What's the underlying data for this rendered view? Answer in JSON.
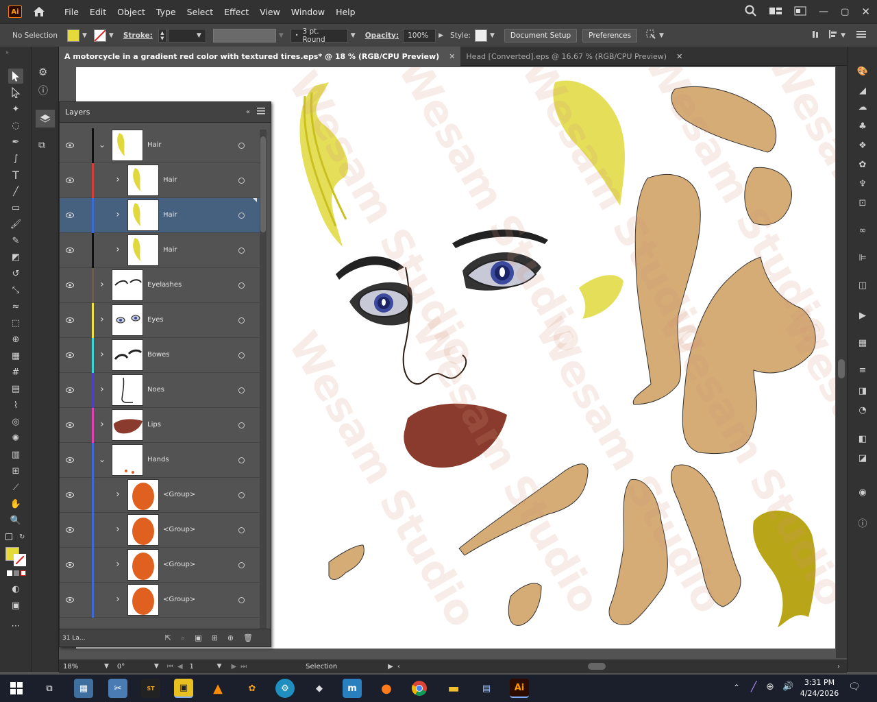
{
  "app": {
    "logo": "Ai",
    "menus": [
      "File",
      "Edit",
      "Object",
      "Type",
      "Select",
      "Effect",
      "View",
      "Window",
      "Help"
    ]
  },
  "control_bar": {
    "selection": "No Selection",
    "fill_color": "#e6d93b",
    "stroke_label": "Stroke:",
    "stroke_profile": "3 pt. Round",
    "opacity_label": "Opacity:",
    "opacity_value": "100%",
    "style_label": "Style:",
    "document_setup": "Document Setup",
    "preferences": "Preferences"
  },
  "tabs": [
    {
      "label": "A motorcycle in a gradient red color with textured tires.eps* @ 18 % (RGB/CPU Preview)",
      "active": true
    },
    {
      "label": "Head [Converted].eps @ 16.67 % (RGB/CPU Preview)",
      "active": false
    }
  ],
  "layers_panel": {
    "title": "Layers",
    "footer_count": "31 La...",
    "rows": [
      {
        "name": "Hair",
        "color": "#111111",
        "level": 0,
        "expanded": true,
        "selected": false
      },
      {
        "name": "Hair",
        "color": "#d53d3d",
        "level": 1,
        "expanded": false,
        "selected": false
      },
      {
        "name": "Hair",
        "color": "#3a6ad6",
        "level": 1,
        "expanded": false,
        "selected": true
      },
      {
        "name": "Hair",
        "color": "#111111",
        "level": 1,
        "expanded": false,
        "selected": false
      },
      {
        "name": "Eyelashes",
        "color": "#6b5d4e",
        "level": 0,
        "expanded": false,
        "selected": false
      },
      {
        "name": "Eyes",
        "color": "#f0e040",
        "level": 0,
        "expanded": false,
        "selected": false
      },
      {
        "name": "Bowes",
        "color": "#3ad6d6",
        "level": 0,
        "expanded": false,
        "selected": false
      },
      {
        "name": "Noes",
        "color": "#5040c0",
        "level": 0,
        "expanded": false,
        "selected": false
      },
      {
        "name": "Lips",
        "color": "#e040b0",
        "level": 0,
        "expanded": false,
        "selected": false
      },
      {
        "name": "Hands",
        "color": "#3a6ad6",
        "level": 0,
        "expanded": true,
        "selected": false
      },
      {
        "name": "<Group>",
        "color": "#3a6ad6",
        "level": 1,
        "expanded": false,
        "selected": false
      },
      {
        "name": "<Group>",
        "color": "#3a6ad6",
        "level": 1,
        "expanded": false,
        "selected": false
      },
      {
        "name": "<Group>",
        "color": "#3a6ad6",
        "level": 1,
        "expanded": false,
        "selected": false
      },
      {
        "name": "<Group>",
        "color": "#3a6ad6",
        "level": 1,
        "expanded": false,
        "selected": false
      }
    ]
  },
  "status_bar": {
    "zoom": "18%",
    "rotation": "0°",
    "artboard": "1",
    "tool": "Selection"
  },
  "watermark": "Wesam Studio",
  "taskbar": {
    "time": "3:31 PM",
    "date": "4/24/2026"
  }
}
